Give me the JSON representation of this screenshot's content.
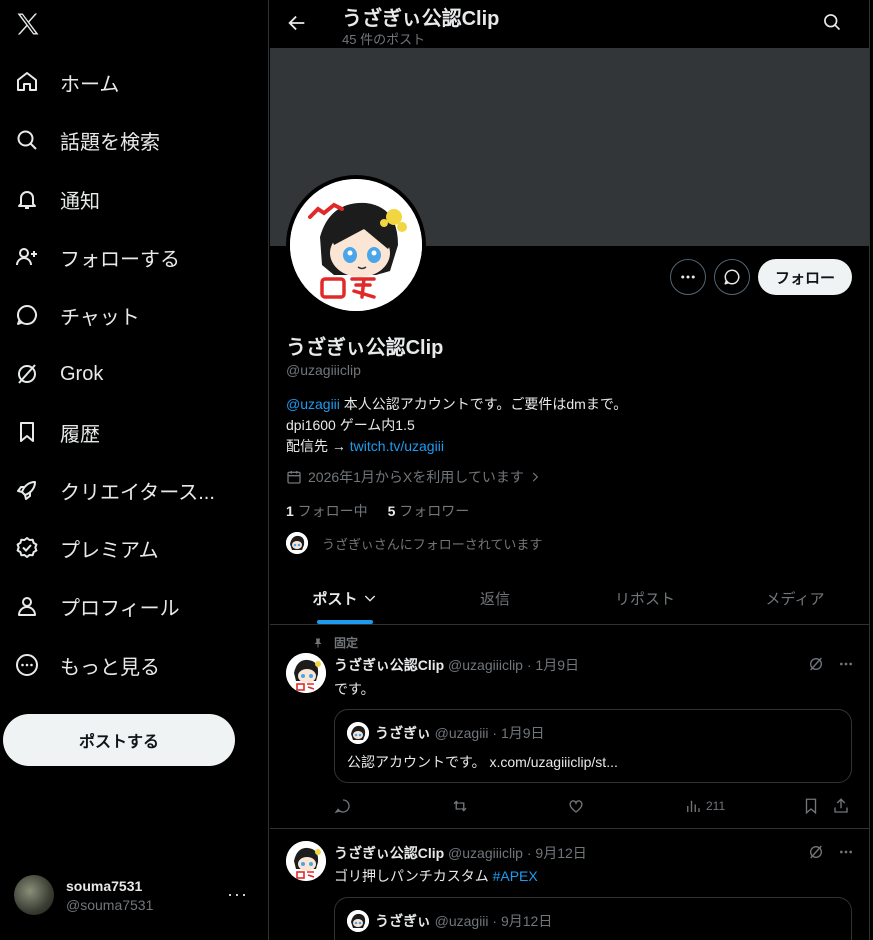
{
  "nav": {
    "items": [
      {
        "label": "ホーム",
        "icon": "home-icon"
      },
      {
        "label": "話題を検索",
        "icon": "search-icon"
      },
      {
        "label": "通知",
        "icon": "bell-icon"
      },
      {
        "label": "フォローする",
        "icon": "follow-icon"
      },
      {
        "label": "チャット",
        "icon": "chat-icon"
      },
      {
        "label": "Grok",
        "icon": "grok-icon"
      },
      {
        "label": "履歴",
        "icon": "bookmark-icon"
      },
      {
        "label": "クリエイタース...",
        "icon": "rocket-icon"
      },
      {
        "label": "プレミアム",
        "icon": "verified-icon"
      },
      {
        "label": "プロフィール",
        "icon": "person-icon"
      },
      {
        "label": "もっと見る",
        "icon": "more-circle-icon"
      }
    ],
    "post_button": "ポストする"
  },
  "account": {
    "display_name": "souma7531",
    "handle": "@souma7531",
    "more": "···"
  },
  "header": {
    "title": "うざぎぃ公認Clip",
    "subtitle": "45 件のポスト"
  },
  "profile": {
    "follow_label": "フォロー",
    "name": "うざぎぃ公認Clip",
    "handle": "@uzagiiiclip",
    "bio": {
      "mention": "@uzagiii",
      "line1_rest": " 本人公認アカウントです。ご要件はdmまで。",
      "line2": "dpi1600 ゲーム内1.5",
      "line3_prefix": "配信先 → ",
      "link": "twitch.tv/uzagiii"
    },
    "joined": "2026年1月からXを利用しています",
    "following_count": "1",
    "following_label": " フォロー中",
    "followers_count": "5",
    "followers_label": " フォロワー",
    "followed_by": "うざぎぃさんにフォローされています"
  },
  "tabs": [
    {
      "label": "ポスト"
    },
    {
      "label": "返信"
    },
    {
      "label": "リポスト"
    },
    {
      "label": "メディア"
    }
  ],
  "tweets": [
    {
      "pinned_label": "固定",
      "name": "うざぎぃ公認Clip",
      "meta": " @uzagiiiclip · 1月9日",
      "text": "です。",
      "quote": {
        "name": "うざぎぃ",
        "meta": " @uzagiii · 1月9日",
        "text": "公認アカウントです。 x.com/uzagiiiclip/st..."
      },
      "views": "211"
    },
    {
      "name": "うざぎぃ公認Clip",
      "meta": " @uzagiiiclip · 9月12日",
      "text": "ゴリ押しパンチカスタム ",
      "hashtag": "#APEX",
      "quote": {
        "name": "うざぎぃ",
        "meta": " @uzagiii · 9月12日"
      }
    }
  ]
}
